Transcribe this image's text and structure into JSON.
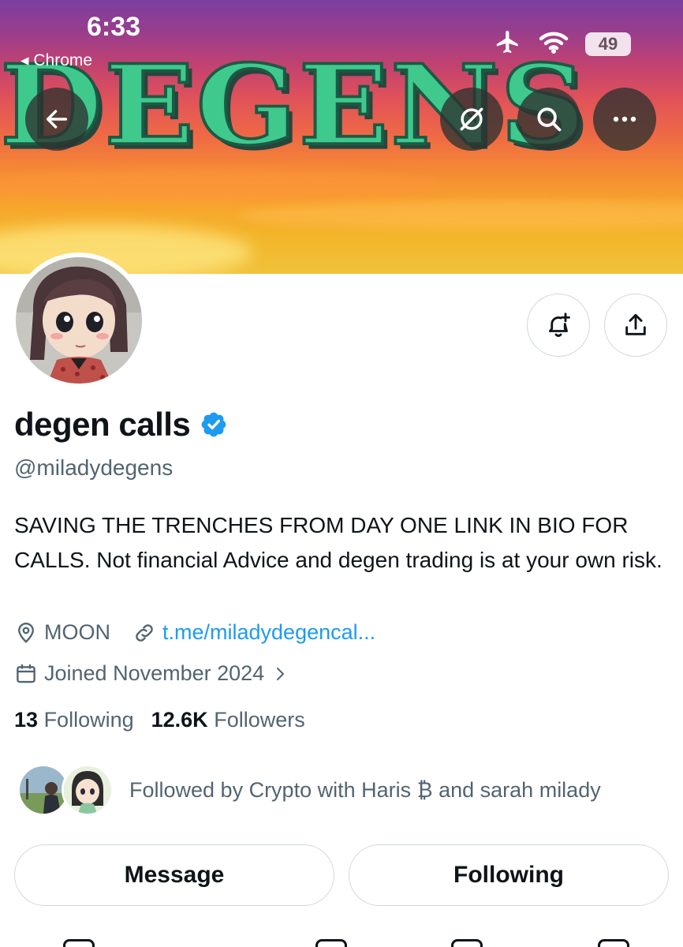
{
  "status_bar": {
    "time": "6:33",
    "back_app": "◂ Chrome",
    "battery": "49",
    "icons": [
      "airplane-icon",
      "wifi-icon",
      "battery-icon"
    ]
  },
  "banner": {
    "text": "DEGENS",
    "colors": {
      "sky_top": "#7a3fa0",
      "sky_mid": "#ef6a44",
      "sky_bottom": "#f0c23a",
      "letter_fill": "#3fc98d"
    }
  },
  "header": {
    "back_icon": "arrow-left-icon",
    "grok_icon": "grok-icon",
    "search_icon": "search-icon",
    "more_icon": "more-horizontal-icon"
  },
  "profile": {
    "display_name": "degen calls",
    "verified": true,
    "handle": "@miladydegens",
    "bio": "SAVING THE TRENCHES FROM DAY ONE LINK IN BIO FOR CALLS. Not financial Advice and degen trading is at your own risk.",
    "location": "MOON",
    "link": "t.me/miladydegencal...",
    "joined": "Joined November 2024",
    "following_count": "13",
    "following_label": "Following",
    "followers_count": "12.6K",
    "followers_label": "Followers",
    "followed_by": "Followed by Crypto with Haris ₿ and sarah milady"
  },
  "actions": {
    "message_label": "Message",
    "following_label": "Following"
  },
  "colors": {
    "text_primary": "#0f1419",
    "text_secondary": "#536471",
    "link": "#1d9bf0",
    "verified": "#1d9bf0",
    "border": "#cfd9de"
  }
}
